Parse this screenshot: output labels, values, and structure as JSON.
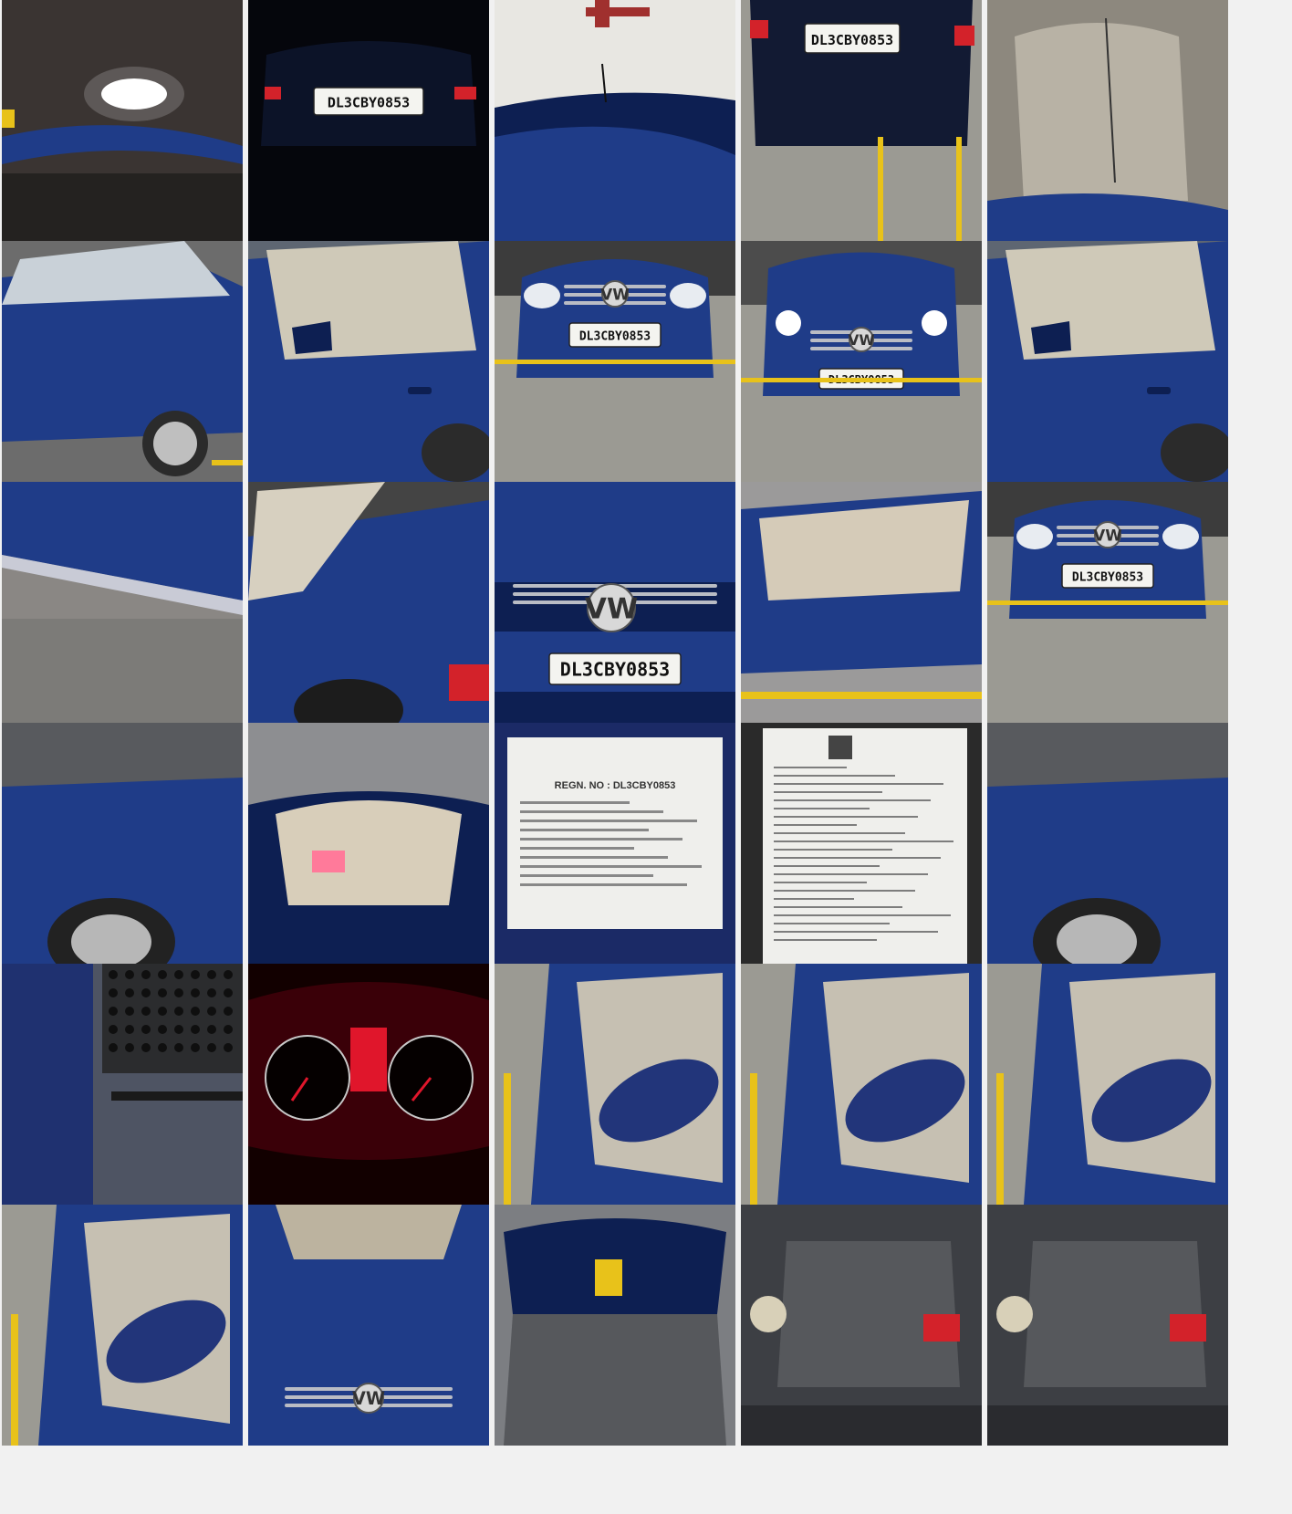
{
  "gallery": {
    "columns": 5,
    "rows": 6,
    "plate_number": "DL3CBY0853",
    "document_heading": "REGN. NO : DL3CBY0853",
    "colors": {
      "background": "#f1f1f1",
      "car_blue": "#1f3c88",
      "car_blue_dark": "#0d1f52",
      "floor_grey": "#9b9a93",
      "parking_line_yellow": "#e8c21a",
      "plate_white": "#f4f4f0",
      "tail_light_red": "#d3222a",
      "dashboard_red": "#e0162b",
      "document_white": "#efefec",
      "engine_grey": "#56585c"
    },
    "photos": [
      {
        "name": "photo-headlight-glare",
        "scene": "glare",
        "alt": "Headlight glare on car side"
      },
      {
        "name": "photo-rear-plate-night",
        "scene": "rear-night",
        "alt": "Rear view with number plate at night"
      },
      {
        "name": "photo-roof-antenna",
        "scene": "roof",
        "alt": "Roof with antenna"
      },
      {
        "name": "photo-rear-plate",
        "scene": "rear",
        "alt": "Rear view with number plate"
      },
      {
        "name": "photo-rear-windshield",
        "scene": "window",
        "alt": "Windshield interior view"
      },
      {
        "name": "photo-left-side",
        "scene": "side",
        "alt": "Left side view"
      },
      {
        "name": "photo-driver-door",
        "scene": "door",
        "alt": "Driver door with mirror"
      },
      {
        "name": "photo-front-plate",
        "scene": "front",
        "alt": "Front view with number plate"
      },
      {
        "name": "photo-front-headlights-on",
        "scene": "front-lit",
        "alt": "Front view with headlights on"
      },
      {
        "name": "photo-rear-door",
        "scene": "door",
        "alt": "Rear door view"
      },
      {
        "name": "photo-sill-scratches",
        "scene": "sill",
        "alt": "Door sill damage"
      },
      {
        "name": "photo-rear-quarter",
        "scene": "quarter",
        "alt": "Rear quarter panel"
      },
      {
        "name": "photo-front-grille-plate",
        "scene": "grille",
        "alt": "Front grille close-up with plate"
      },
      {
        "name": "photo-open-doors-interior",
        "scene": "interior-side",
        "alt": "Side view with interior"
      },
      {
        "name": "photo-front-full",
        "scene": "front",
        "alt": "Full front view"
      },
      {
        "name": "photo-front-fender",
        "scene": "fender",
        "alt": "Front fender with open bonnet"
      },
      {
        "name": "photo-rear-interior",
        "scene": "rear-interior",
        "alt": "Rear seats through window"
      },
      {
        "name": "photo-registration-certificate",
        "scene": "doc",
        "alt": "Registration certificate"
      },
      {
        "name": "photo-insurance-document",
        "scene": "doc2",
        "alt": "Insurance document"
      },
      {
        "name": "photo-right-fender",
        "scene": "fender",
        "alt": "Right fender with open bonnet"
      },
      {
        "name": "photo-chassis-number",
        "scene": "chassis",
        "alt": "Chassis number plate area"
      },
      {
        "name": "photo-instrument-cluster",
        "scene": "dash",
        "alt": "Instrument cluster"
      },
      {
        "name": "photo-left-mirror",
        "scene": "mirror",
        "alt": "Left mirror and window"
      },
      {
        "name": "photo-right-mirror",
        "scene": "mirror",
        "alt": "Right mirror and window"
      },
      {
        "name": "photo-mirror-closeup",
        "scene": "mirror",
        "alt": "Mirror close-up"
      },
      {
        "name": "photo-mirror-glass",
        "scene": "mirror",
        "alt": "Mirror glass"
      },
      {
        "name": "photo-bonnet-front",
        "scene": "bonnet",
        "alt": "Bonnet and front grille"
      },
      {
        "name": "photo-open-bonnet",
        "scene": "open-bonnet",
        "alt": "Open bonnet"
      },
      {
        "name": "photo-engine-bay",
        "scene": "engine",
        "alt": "Engine bay"
      },
      {
        "name": "photo-engine-detail",
        "scene": "engine",
        "alt": "Engine detail"
      }
    ]
  }
}
